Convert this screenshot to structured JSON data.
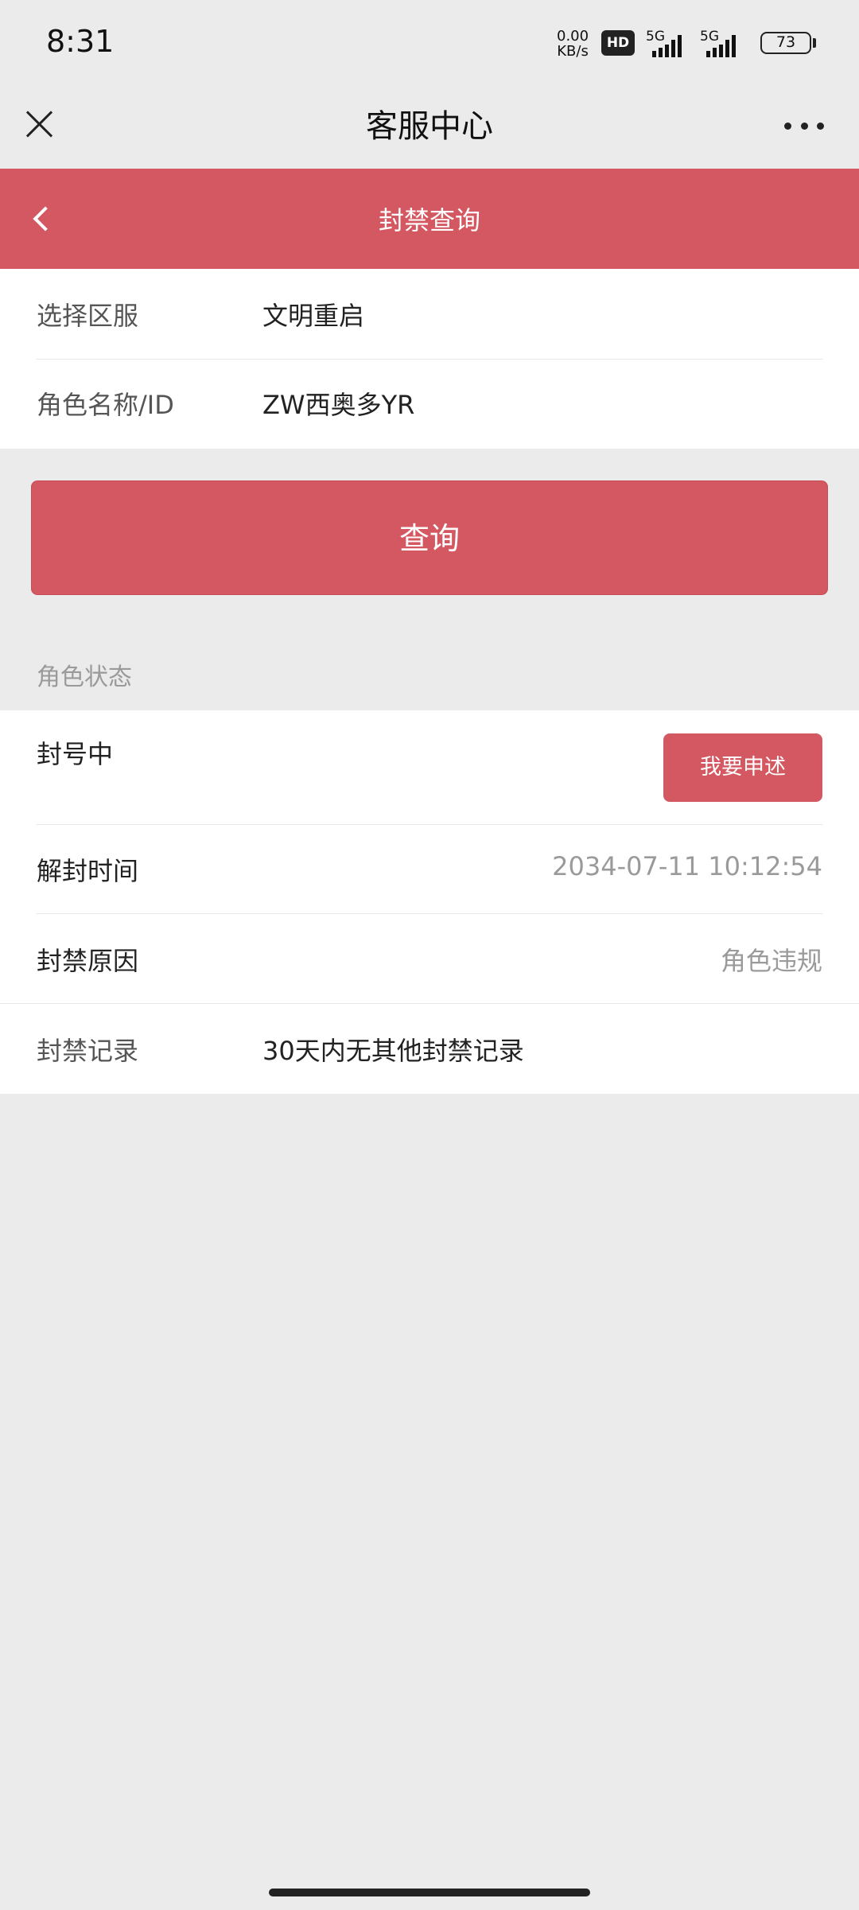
{
  "status_bar": {
    "time": "8:31",
    "net_speed_value": "0.00",
    "net_speed_unit": "KB/s",
    "hd_badge": "HD",
    "signal_1_label": "5G",
    "signal_2_label": "5G",
    "battery_level": "73"
  },
  "title_bar": {
    "title": "客服中心"
  },
  "header": {
    "page_title": "封禁查询"
  },
  "form": {
    "server_label": "选择区服",
    "server_value": "文明重启",
    "role_label": "角色名称/ID",
    "role_value": "ZW西奥多YR"
  },
  "query_button": "查询",
  "role_status": {
    "section_title": "角色状态",
    "status": "封号中",
    "appeal_button": "我要申述",
    "unban_time_label": "解封时间",
    "unban_time_value": "2034-07-11 10:12:54",
    "ban_reason_label": "封禁原因",
    "ban_reason_value": "角色违规",
    "ban_record_label": "封禁记录",
    "ban_record_value": "30天内无其他封禁记录"
  },
  "colors": {
    "accent": "#d45862",
    "background": "#ebebeb"
  }
}
